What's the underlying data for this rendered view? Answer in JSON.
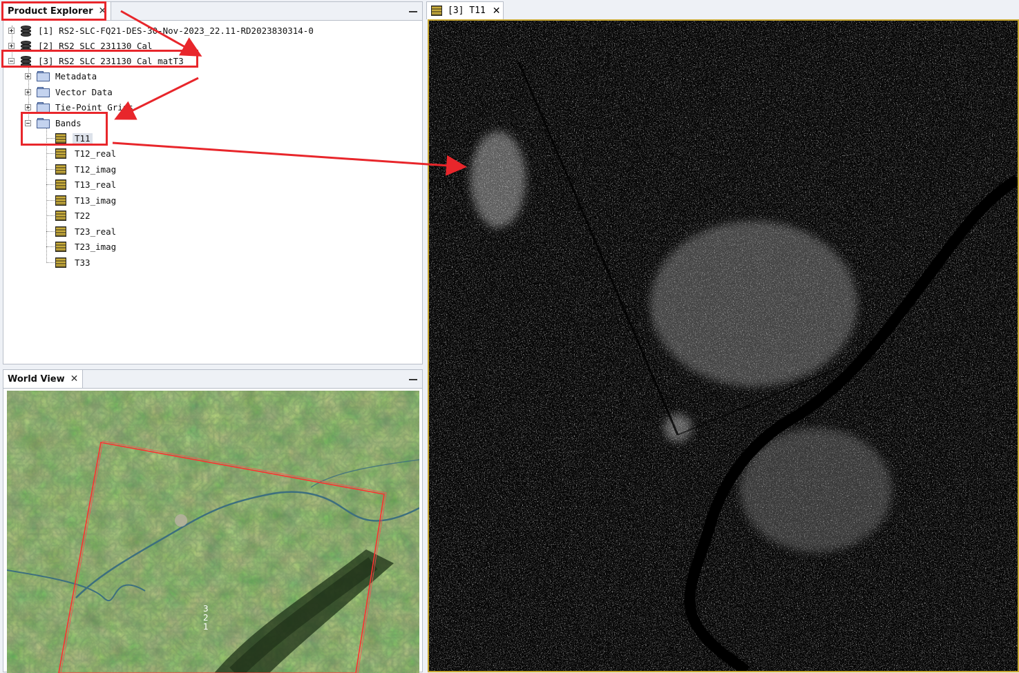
{
  "product_explorer": {
    "title": "Product Explorer",
    "close_glyph": "✕",
    "products": [
      {
        "label": "[1] RS2-SLC-FQ21-DES-30-Nov-2023_22.11-RD2023830314-0",
        "expanded": false
      },
      {
        "label": "[2] RS2_SLC_231130_Cal",
        "expanded": false
      },
      {
        "label": "[3] RS2_SLC_231130_Cal_matT3",
        "expanded": true
      }
    ],
    "groups": [
      {
        "label": "Metadata",
        "expanded": false
      },
      {
        "label": "Vector Data",
        "expanded": false
      },
      {
        "label": "Tie-Point Grids",
        "expanded": false
      },
      {
        "label": "Bands",
        "expanded": true
      }
    ],
    "bands": [
      "T11",
      "T12_real",
      "T12_imag",
      "T13_real",
      "T13_imag",
      "T22",
      "T23_real",
      "T23_imag",
      "T33"
    ],
    "selected_band": "T11"
  },
  "world_view": {
    "title": "World View",
    "close_glyph": "✕",
    "footprint_labels": [
      "3",
      "2",
      "1"
    ]
  },
  "image_view": {
    "tab_label": "[3] T11",
    "close_glyph": "✕"
  },
  "colors": {
    "annotation": "#e8262b",
    "view_border": "#c9a832",
    "selection": "#dde2ea"
  }
}
